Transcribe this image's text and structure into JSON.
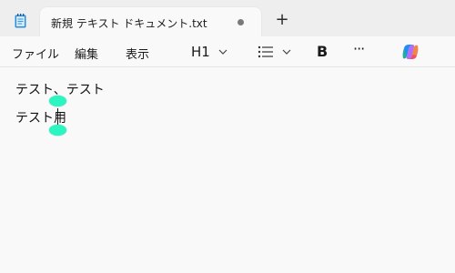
{
  "tab": {
    "title": "新規 テキスト ドキュメント.txt",
    "new_tab": "+"
  },
  "menu": {
    "file": "ファイル",
    "edit": "編集",
    "view": "表示"
  },
  "toolbar": {
    "heading": "H1",
    "bold": "B",
    "more": "···"
  },
  "document": {
    "lines": [
      "テスト、テスト",
      "テスト用"
    ]
  },
  "icons": {
    "app": "notepad-icon",
    "unsaved": "unsaved-dot-icon",
    "list": "bulleted-list-icon",
    "copilot": "copilot-icon"
  },
  "colors": {
    "selection_handle": "#2bf5c0",
    "tabstrip": "#eeeeee",
    "background": "#f9f9f9"
  }
}
